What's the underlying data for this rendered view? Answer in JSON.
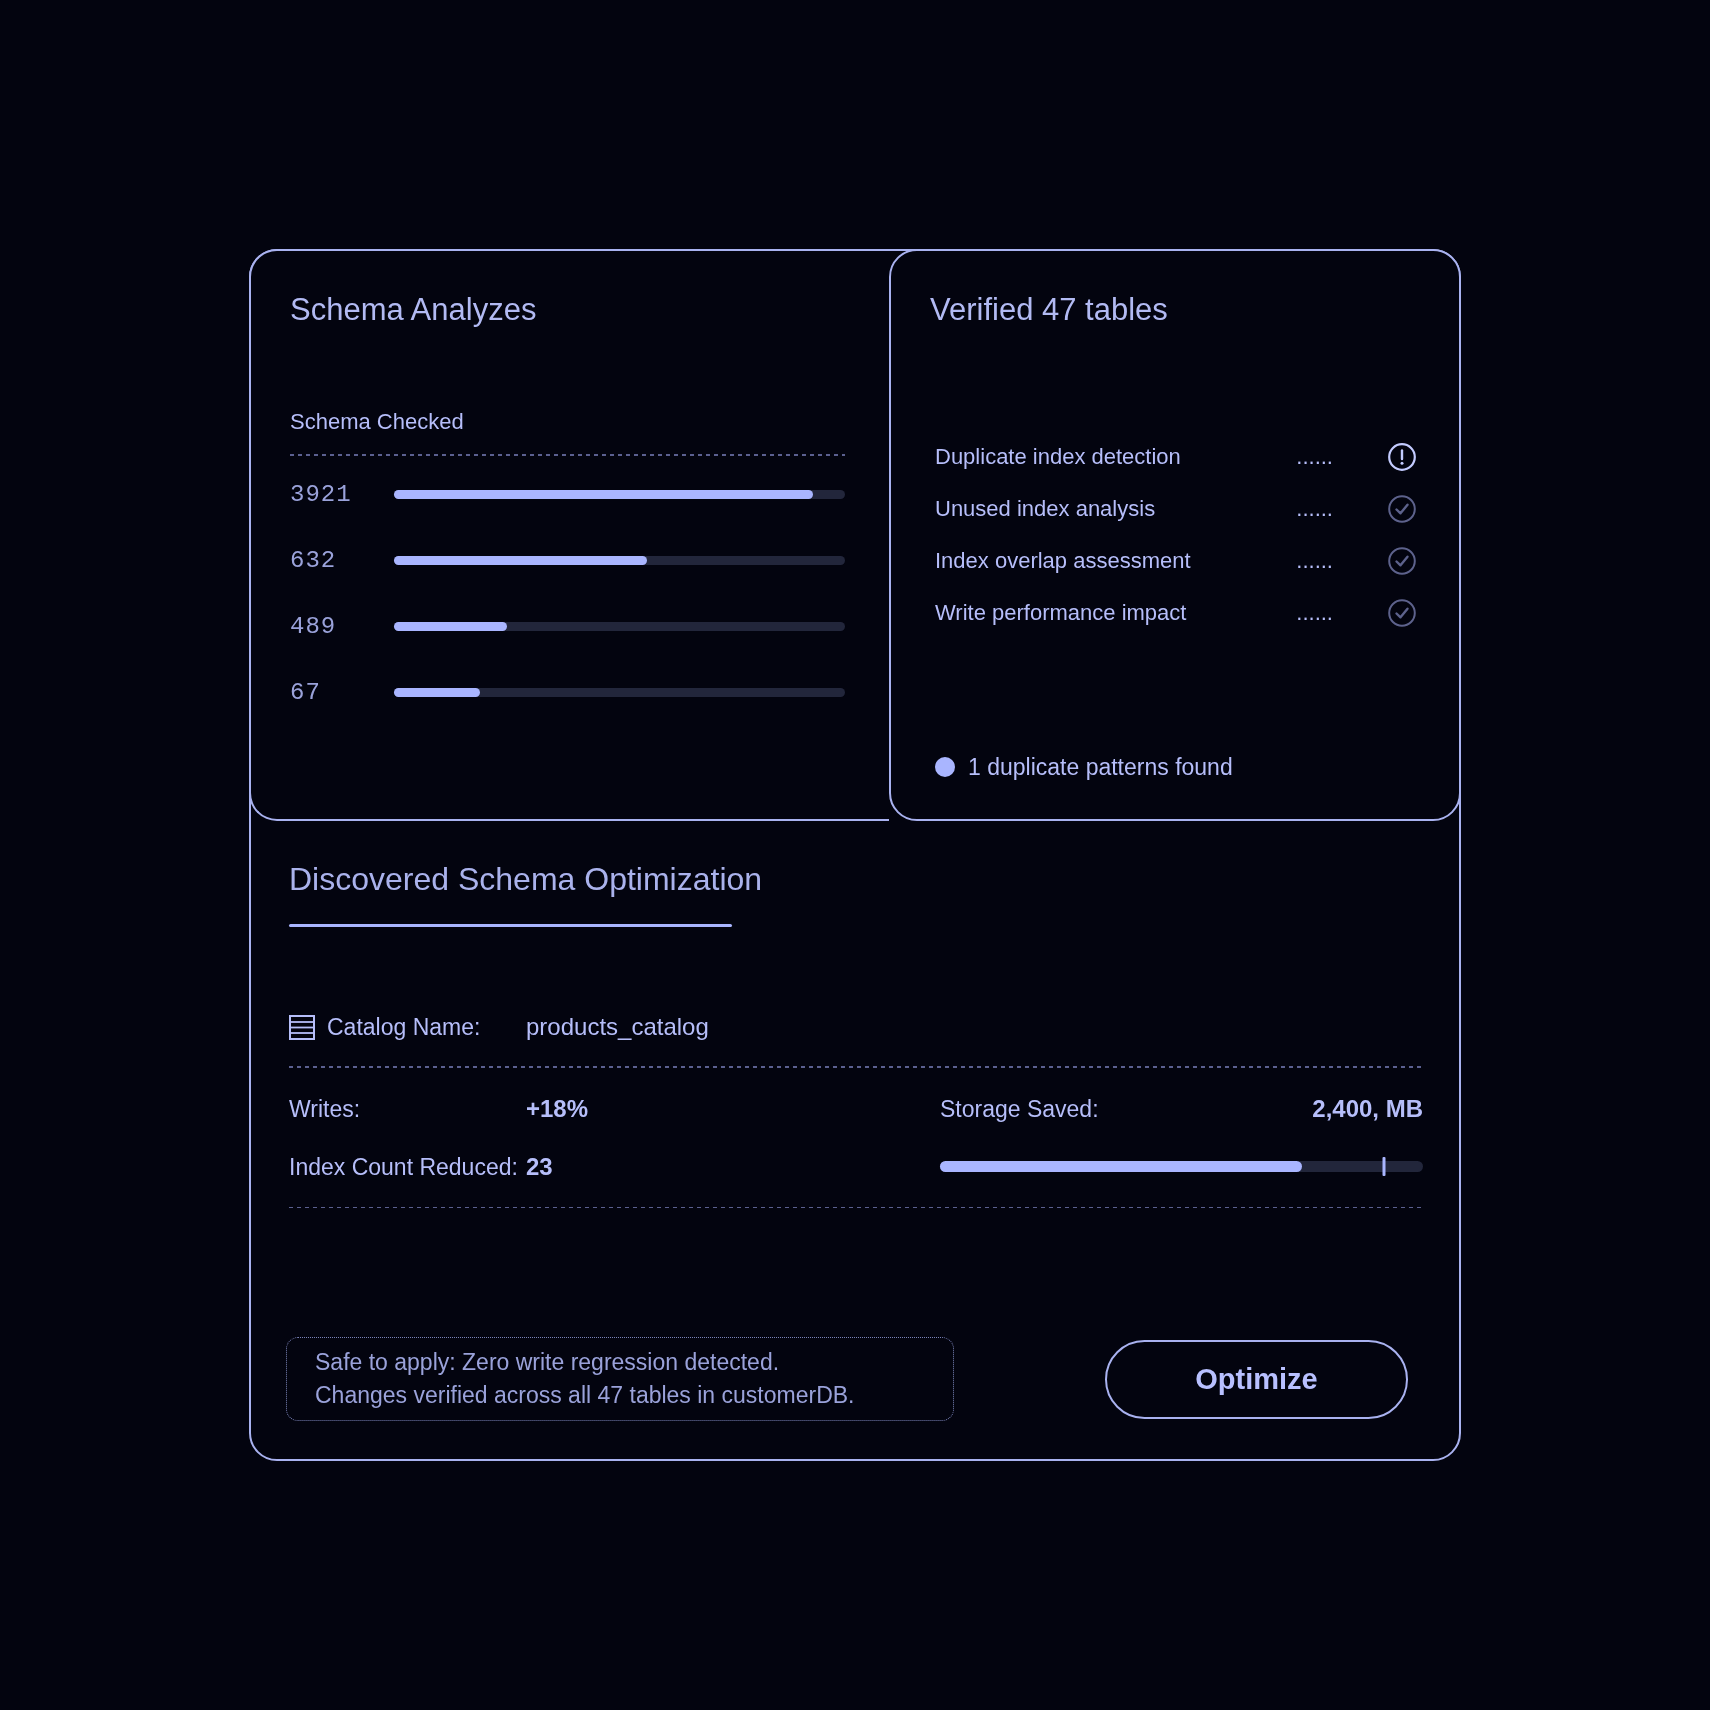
{
  "analysis_panel": {
    "title": "Schema Analyzes",
    "subtitle": "Schema Checked",
    "bars": [
      {
        "value": "3921",
        "level": 0.93
      },
      {
        "value": "632",
        "level": 0.56
      },
      {
        "value": "489",
        "level": 0.25
      },
      {
        "value": "67",
        "level": 0.19
      }
    ]
  },
  "verification_panel": {
    "title": "Verified 47 tables",
    "checks": [
      {
        "label": "Duplicate index detection",
        "leader": "......",
        "kind": "warning"
      },
      {
        "label": "Unused index analysis",
        "leader": "......",
        "kind": "passed"
      },
      {
        "label": "Index overlap assessment",
        "leader": "......",
        "kind": "passed"
      },
      {
        "label": "Write performance impact",
        "leader": "......",
        "kind": "passed"
      }
    ],
    "summary": "1 duplicate patterns found"
  },
  "optimization": {
    "title": "Discovered Schema Optimization",
    "catalog": {
      "label": "Catalog Name:",
      "value": "products_catalog"
    },
    "stats": [
      {
        "label": "Writes:",
        "value": "+18%"
      },
      {
        "label": "Index Count Reduced:",
        "value": "23"
      }
    ],
    "storage": {
      "label": "Storage Saved:",
      "value": "2,400, MB",
      "level": 0.75,
      "marker": {
        "level": 0.92
      }
    },
    "note": {
      "lines": [
        "Safe to apply: Zero write regression detected.",
        "Changes verified across all 47 tables in customerDB."
      ]
    },
    "button": {
      "label": "Optimize"
    }
  }
}
